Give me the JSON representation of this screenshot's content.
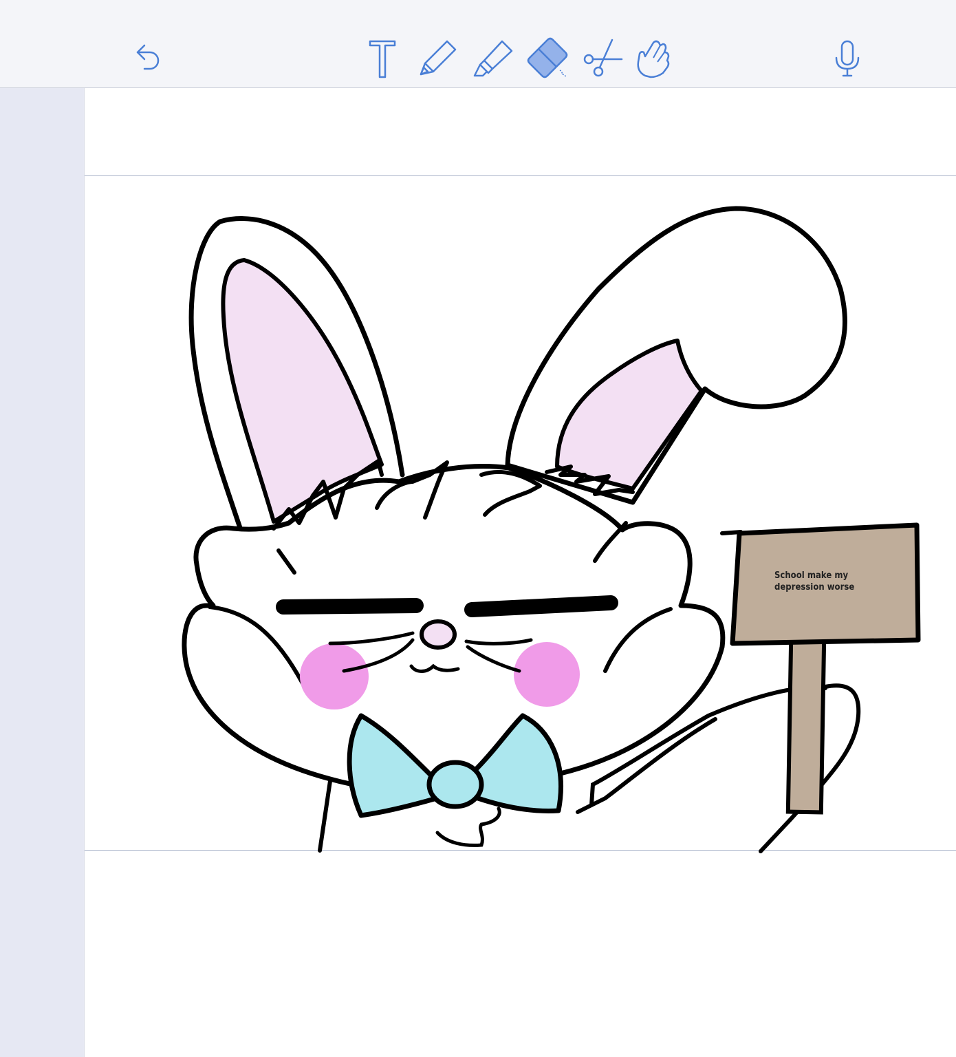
{
  "toolbar": {
    "icon_color": "#4a7fd6",
    "active_fill": "#94b2ea",
    "tools": [
      {
        "name": "undo-icon"
      },
      {
        "name": "text-tool-icon"
      },
      {
        "name": "pencil-icon"
      },
      {
        "name": "highlighter-icon"
      },
      {
        "name": "eraser-icon",
        "active": true
      },
      {
        "name": "scissors-icon"
      },
      {
        "name": "hand-pointer-icon"
      },
      {
        "name": "microphone-icon"
      }
    ]
  },
  "drawing": {
    "sign_text": "School make my depression worse",
    "colors": {
      "outline": "#000000",
      "inner_ear": "#f3e0f3",
      "blush": "#f09be8",
      "bowtie": "#ace7ee",
      "sign_board": "#bfad9a",
      "sign_post": "#bfad9a"
    }
  }
}
